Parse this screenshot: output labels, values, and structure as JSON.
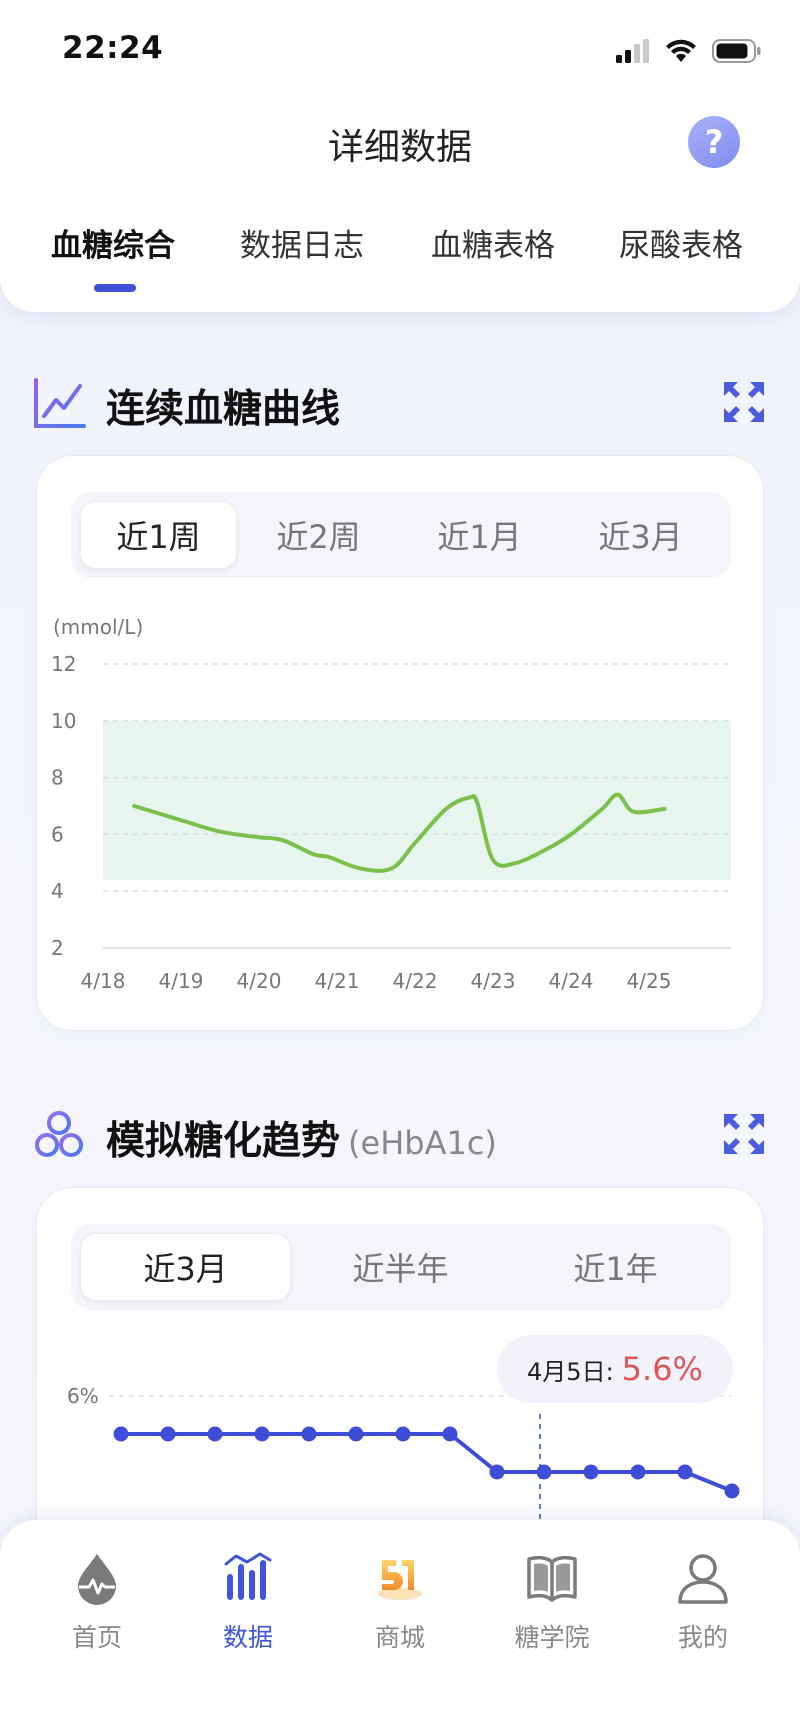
{
  "status_bar": {
    "time": "22:24"
  },
  "nav": {
    "title": "详细数据",
    "help_label": "?"
  },
  "top_tabs": [
    {
      "label": "血糖综合",
      "active": true
    },
    {
      "label": "数据日志",
      "active": false
    },
    {
      "label": "血糖表格",
      "active": false
    },
    {
      "label": "尿酸表格",
      "active": false
    }
  ],
  "glucose_section": {
    "title": "连续血糖曲线",
    "ranges": [
      {
        "label": "近1周",
        "active": true
      },
      {
        "label": "近2周",
        "active": false
      },
      {
        "label": "近1月",
        "active": false
      },
      {
        "label": "近3月",
        "active": false
      }
    ]
  },
  "hba1c_section": {
    "title": "模拟糖化趋势",
    "subtitle": "(eHbA1c)",
    "ranges": [
      {
        "label": "近3月",
        "active": true
      },
      {
        "label": "近半年",
        "active": false
      },
      {
        "label": "近1年",
        "active": false
      }
    ],
    "tooltip": {
      "label": "4月5日:",
      "value": "5.6%"
    }
  },
  "bottom_tabs": [
    {
      "label": "首页",
      "icon": "home-drop-icon",
      "active": false
    },
    {
      "label": "数据",
      "icon": "data-chart-icon",
      "active": true
    },
    {
      "label": "商城",
      "icon": "mall-51-icon",
      "active": false
    },
    {
      "label": "糖学院",
      "icon": "book-icon",
      "active": false
    },
    {
      "label": "我的",
      "icon": "user-icon",
      "active": false
    }
  ],
  "colors": {
    "accent": "#3f4fd8",
    "glucose_line": "#7cc04c",
    "target_band": "#e6f6ee",
    "hba1c_line": "#3d4dd8",
    "tooltip_value": "#e05555"
  },
  "chart_data": [
    {
      "type": "line",
      "ylabel": "(mmol/L)",
      "y_ticks": [
        2,
        4,
        6,
        8,
        10,
        12
      ],
      "ylim": [
        2,
        12
      ],
      "x_tick_labels": [
        "4/18",
        "4/19",
        "4/20",
        "4/21",
        "4/22",
        "4/23",
        "4/24",
        "4/25"
      ],
      "target_range": [
        4.4,
        10
      ],
      "grid": "dashed horizontal",
      "series": [
        {
          "x": [
            0.4,
            1.0,
            1.5,
            2.0,
            2.3,
            2.7,
            2.9,
            3.3,
            3.7,
            4.0,
            4.4,
            4.7,
            4.8,
            5.0,
            5.3,
            5.7,
            6.0,
            6.4,
            6.6,
            6.8,
            7.2
          ],
          "y": [
            7.0,
            6.5,
            6.1,
            5.9,
            5.8,
            5.3,
            5.2,
            4.8,
            4.8,
            5.7,
            6.9,
            7.3,
            7.1,
            5.1,
            5.0,
            5.5,
            6.0,
            6.9,
            7.4,
            6.8,
            6.9
          ]
        }
      ]
    },
    {
      "type": "line",
      "y_ticks_labeled": [
        "6%"
      ],
      "grid": "dashed horizontal",
      "marker": "4月5日",
      "series": [
        {
          "values": [
            5.8,
            5.8,
            5.8,
            5.8,
            5.8,
            5.8,
            5.8,
            5.8,
            5.6,
            5.6,
            5.6,
            5.6,
            5.6,
            5.5
          ]
        }
      ]
    }
  ]
}
